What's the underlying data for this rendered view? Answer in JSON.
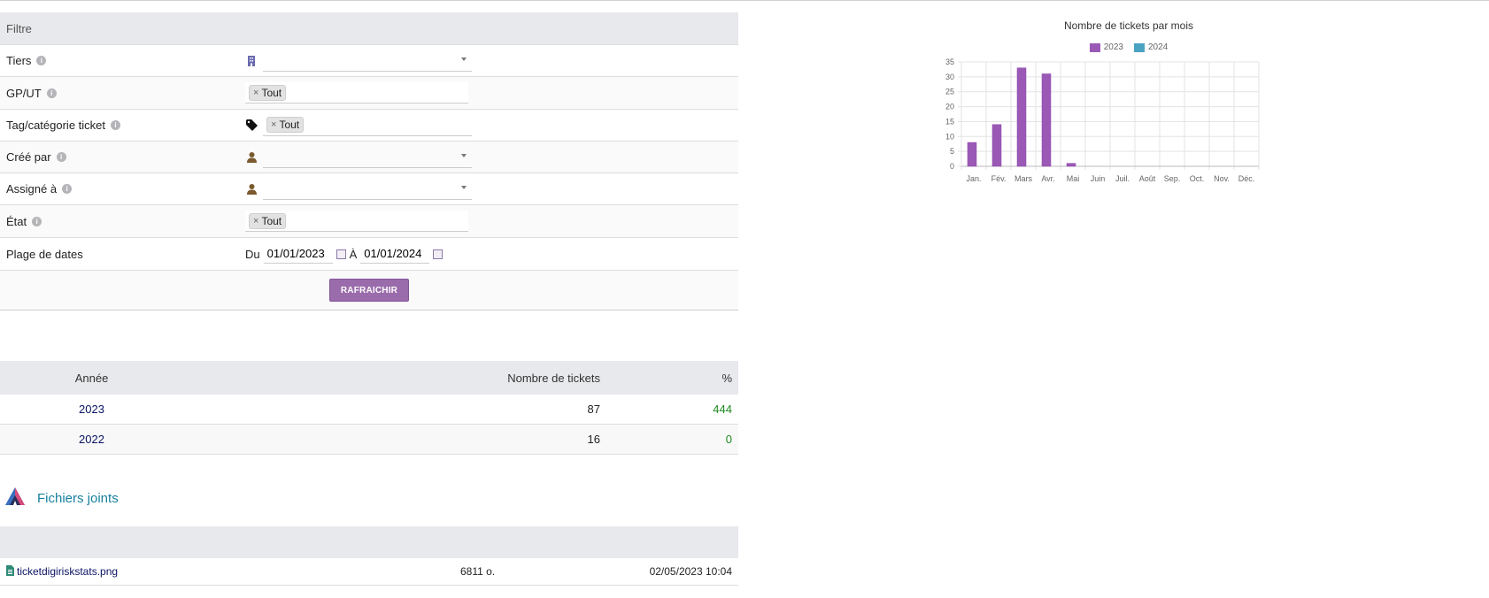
{
  "filter": {
    "header": "Filtre",
    "rows": [
      {
        "label": "Tiers"
      },
      {
        "label": "GP/UT",
        "chip": "Tout"
      },
      {
        "label": "Tag/catégorie ticket",
        "chip": "Tout"
      },
      {
        "label": "Créé par"
      },
      {
        "label": "Assigné à"
      },
      {
        "label": "État",
        "chip": "Tout"
      },
      {
        "label": "Plage de dates"
      }
    ],
    "date": {
      "from_label": "Du",
      "from": "01/01/2023",
      "to_label": "À",
      "to": "01/01/2024"
    },
    "refresh": "RAFRAICHIR",
    "chip_remove": "×"
  },
  "stats": {
    "headers": [
      "Année",
      "Nombre de tickets",
      "%"
    ],
    "rows": [
      {
        "year": "2023",
        "count": "87",
        "pct": "444"
      },
      {
        "year": "2022",
        "count": "16",
        "pct": "0"
      }
    ]
  },
  "attachments": {
    "title": "Fichiers joints",
    "file": {
      "name": "ticketdigiriskstats.png",
      "size": "6811 o.",
      "date": "02/05/2023 10:04"
    }
  },
  "chart_data": {
    "type": "bar",
    "title": "Nombre de tickets par mois",
    "categories": [
      "Jan.",
      "Fév.",
      "Mars",
      "Avr.",
      "Mai",
      "Juin",
      "Juil.",
      "Août",
      "Sep.",
      "Oct.",
      "Nov.",
      "Déc."
    ],
    "series": [
      {
        "name": "2023",
        "values": [
          8,
          14,
          33,
          31,
          1,
          0,
          0,
          0,
          0,
          0,
          0,
          0
        ],
        "color": "#9b59b6"
      },
      {
        "name": "2024",
        "values": [
          0,
          0,
          0,
          0,
          0,
          0,
          0,
          0,
          0,
          0,
          0,
          0
        ],
        "color": "#4aa3c2"
      }
    ],
    "ylim": [
      0,
      35
    ],
    "yticks": [
      "0",
      "5",
      "10",
      "15",
      "20",
      "25",
      "30",
      "35"
    ],
    "legend_position": "top",
    "grid": true
  },
  "colors": {
    "accent": "#9a6cab",
    "link": "#0a1464",
    "positive": "#1f8a1f",
    "attach_title": "#17819e"
  }
}
